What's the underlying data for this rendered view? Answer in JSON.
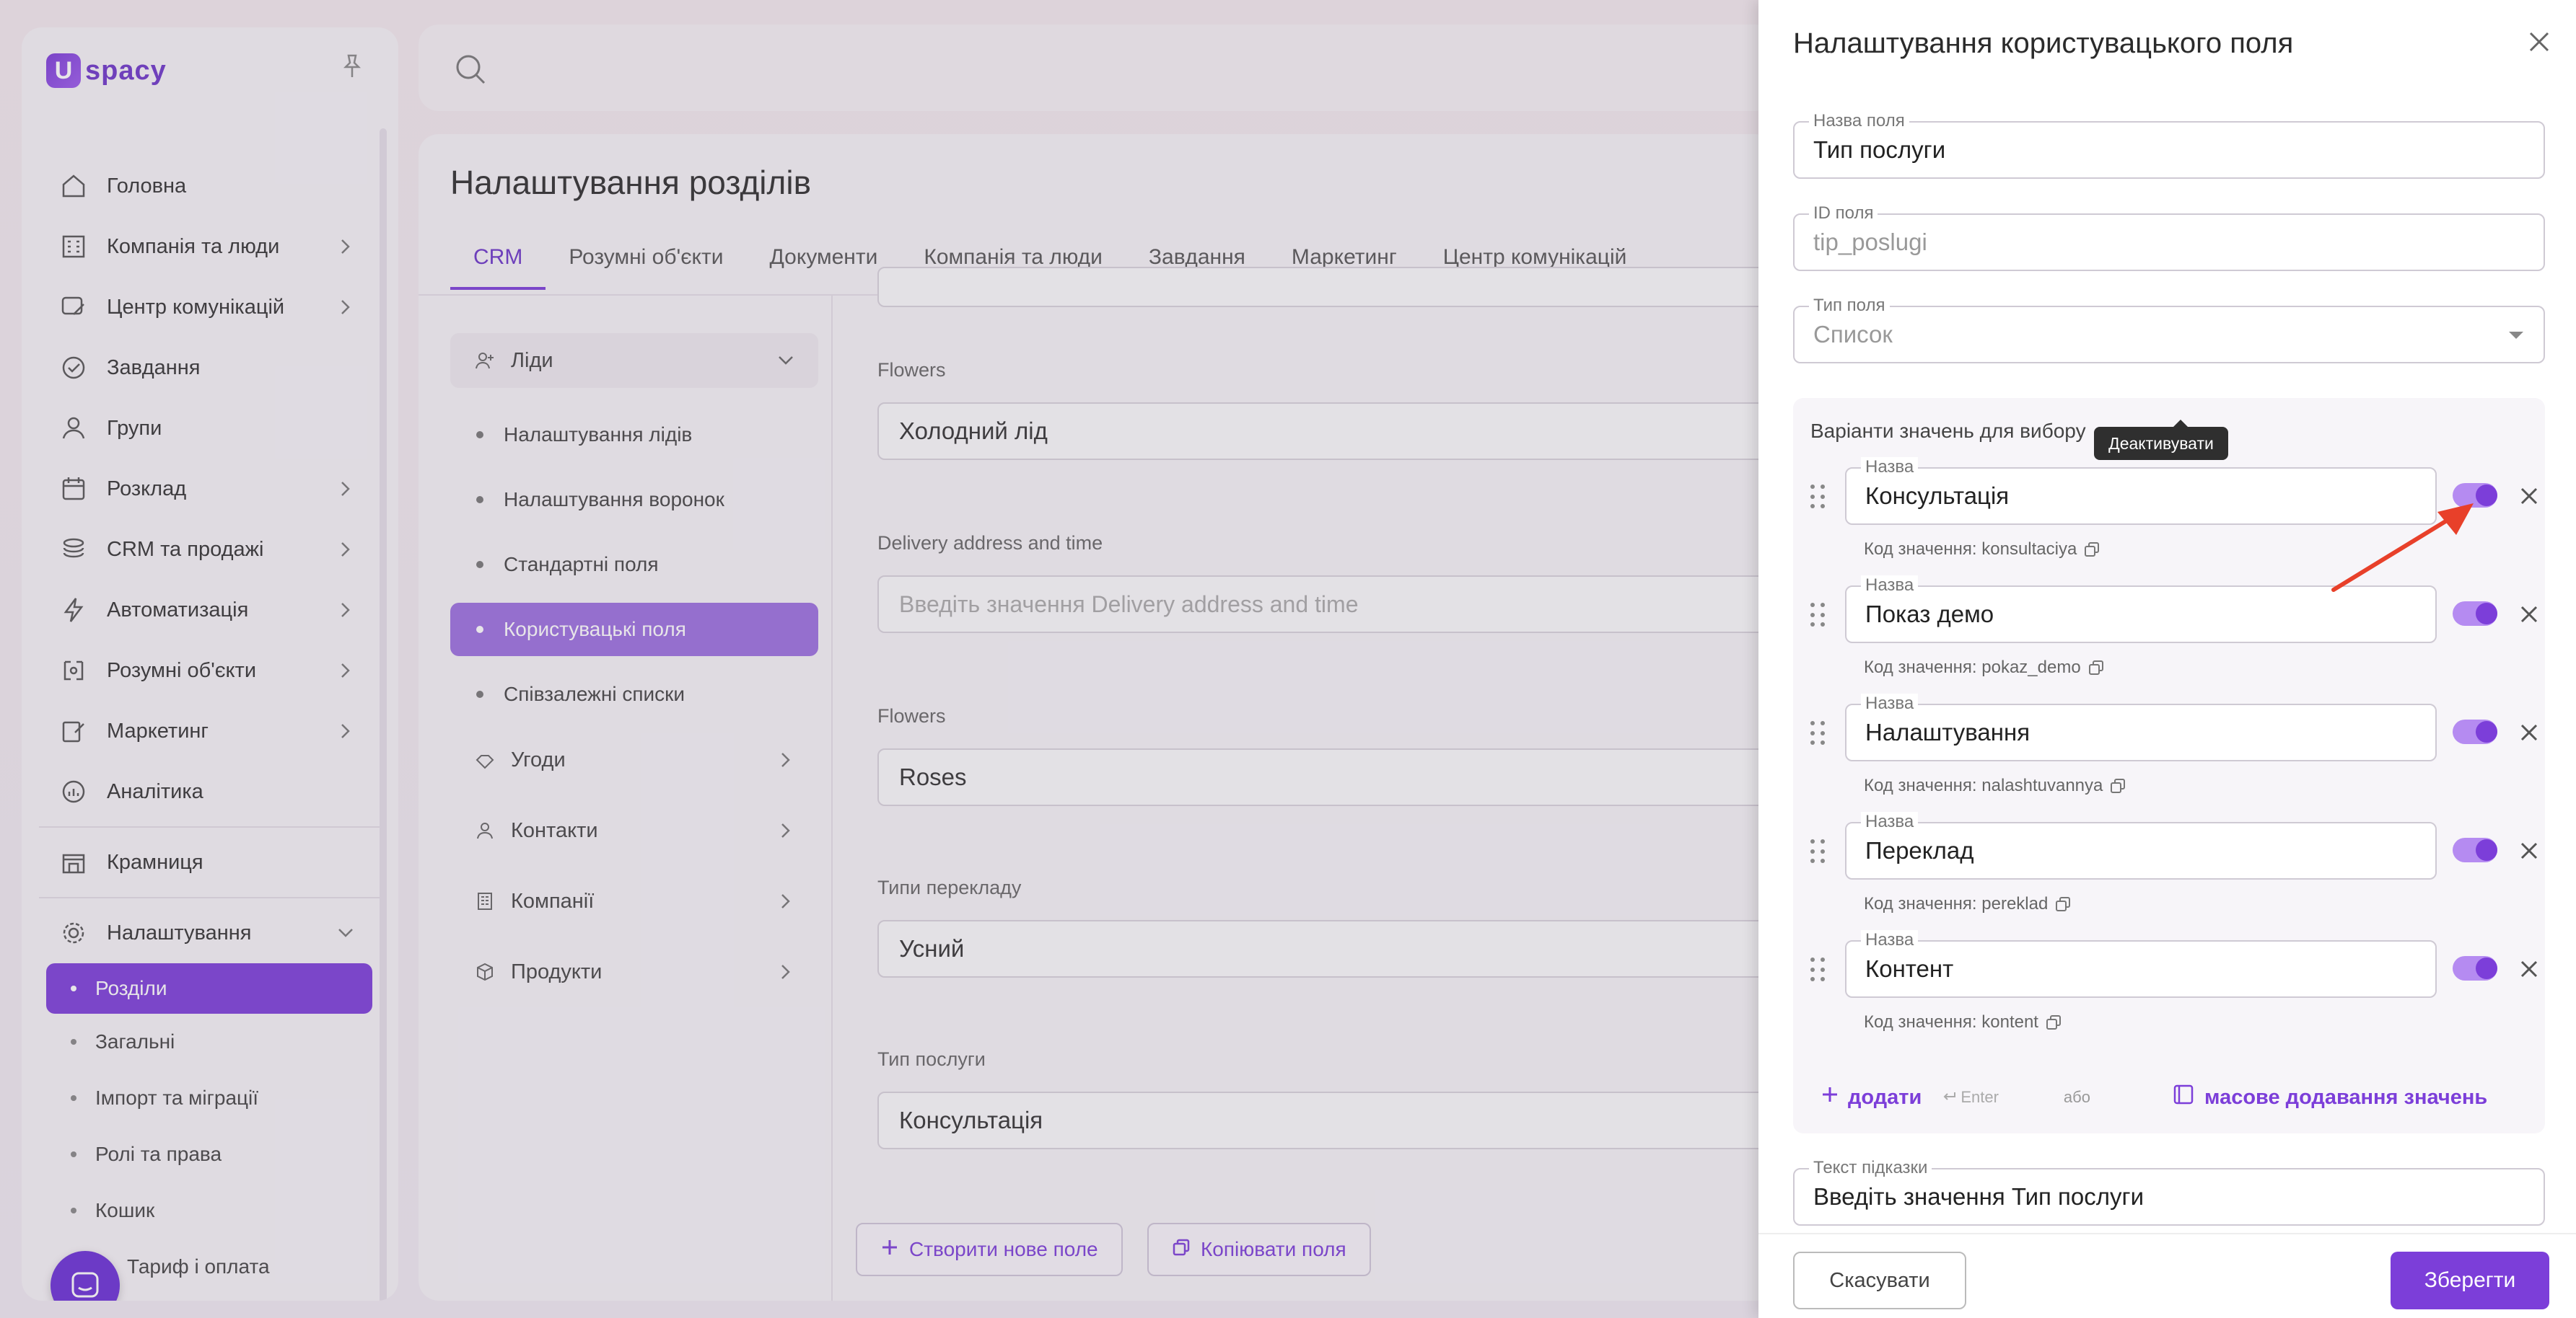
{
  "app": {
    "logo_text": "spacy",
    "logo_mark": "U"
  },
  "sidebar": {
    "items": [
      {
        "label": "Головна",
        "icon": "home-icon",
        "has_chevron": false
      },
      {
        "label": "Компанія та люди",
        "icon": "building-icon",
        "has_chevron": true
      },
      {
        "label": "Центр комунікацій",
        "icon": "chat-edit-icon",
        "has_chevron": true
      },
      {
        "label": "Завдання",
        "icon": "check-circle-icon",
        "has_chevron": false
      },
      {
        "label": "Групи",
        "icon": "users-icon",
        "has_chevron": false
      },
      {
        "label": "Розклад",
        "icon": "calendar-icon",
        "has_chevron": true
      },
      {
        "label": "CRM та продажі",
        "icon": "stack-icon",
        "has_chevron": true
      },
      {
        "label": "Автоматизація",
        "icon": "bolt-icon",
        "has_chevron": true
      },
      {
        "label": "Розумні об'єкти",
        "icon": "smart-object-icon",
        "has_chevron": true
      },
      {
        "label": "Маркетинг",
        "icon": "megaphone-icon",
        "has_chevron": true
      },
      {
        "label": "Аналітика",
        "icon": "chart-icon",
        "has_chevron": false
      }
    ],
    "store_label": "Крамниця",
    "settings_label": "Налаштування",
    "settings_sub": [
      {
        "label": "Розділи",
        "active": true
      },
      {
        "label": "Загальні",
        "active": false
      },
      {
        "label": "Імпорт та міграції",
        "active": false
      },
      {
        "label": "Ролі та права",
        "active": false
      },
      {
        "label": "Кошик",
        "active": false
      }
    ],
    "tariff_label": "Тариф і оплата"
  },
  "main": {
    "title": "Налаштування розділів",
    "tabs": [
      "CRM",
      "Розумні об'єкти",
      "Документи",
      "Компанія та люди",
      "Завдання",
      "Маркетинг",
      "Центр комунікацій"
    ],
    "active_tab": "CRM",
    "left_menu": {
      "leads_label": "Ліди",
      "leads_sub": [
        "Налаштування лідів",
        "Налаштування воронок",
        "Стандартні поля",
        "Користувацькі поля",
        "Співзалежні списки"
      ],
      "active_sub": "Користувацькі поля",
      "groups": [
        "Угоди",
        "Контакти",
        "Компанії",
        "Продукти"
      ]
    },
    "fields": [
      {
        "label": "Flowers",
        "value": "Холодний лід",
        "placeholder": false
      },
      {
        "label": "Delivery address and time",
        "value": "Введіть значення Delivery address and time",
        "placeholder": true
      },
      {
        "label": "Flowers",
        "value": "Roses",
        "placeholder": false
      },
      {
        "label": "Типи перекладу",
        "value": "Усний",
        "placeholder": false
      },
      {
        "label": "Тип послуги",
        "value": "Консультація",
        "placeholder": false
      }
    ],
    "create_field_label": "Створити нове поле",
    "copy_fields_label": "Копіювати поля"
  },
  "drawer": {
    "title": "Налаштування користувацького поля",
    "field_name_legend": "Назва поля",
    "field_name_value": "Тип послуги",
    "field_id_legend": "ID поля",
    "field_id_value": "tip_poslugi",
    "field_type_legend": "Тип поля",
    "field_type_value": "Список",
    "variants_title": "Варіанти значень для вибору",
    "variant_legend": "Назва",
    "code_prefix": "Код значення: ",
    "variants": [
      {
        "name": "Консультація",
        "code": "konsultaciya",
        "enabled": true
      },
      {
        "name": "Показ демо",
        "code": "pokaz_demo",
        "enabled": true
      },
      {
        "name": "Налаштування",
        "code": "nalashtuvannya",
        "enabled": true
      },
      {
        "name": "Переклад",
        "code": "pereklad",
        "enabled": true
      },
      {
        "name": "Контент",
        "code": "kontent",
        "enabled": true
      }
    ],
    "add_label": "додати",
    "enter_hint": "Enter",
    "or_label": "або",
    "mass_add_label": "масове додавання значень",
    "hint_legend": "Текст підказки",
    "hint_value": "Введіть значення Тип послуги",
    "tooltip": "Деактивувати",
    "cancel_label": "Скасувати",
    "save_label": "Зберегти"
  },
  "colors": {
    "accent": "#7c3ed9",
    "annotation_arrow": "#e8402a"
  }
}
